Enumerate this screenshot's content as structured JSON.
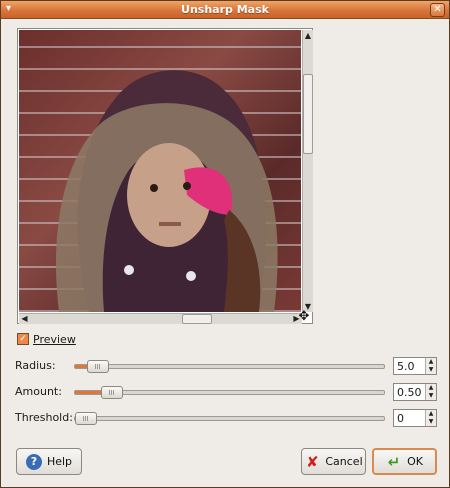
{
  "window": {
    "title": "Unsharp Mask",
    "close_symbol": "✕",
    "menu_symbol": "▾"
  },
  "preview": {
    "label": "Preview",
    "checked": true
  },
  "params": [
    {
      "label": "Radius",
      "value": "5.0",
      "fill": 0.06
    },
    {
      "label": "Amount",
      "value": "0.50",
      "fill": 0.1
    },
    {
      "label": "Threshold",
      "value": "0",
      "fill": 0.0
    }
  ],
  "buttons": {
    "help": "Help",
    "cancel": "Cancel",
    "ok": "OK"
  },
  "icons": {
    "help": "help-icon",
    "cancel": "cancel-icon",
    "ok": "ok-arrow-icon",
    "navigate": "navigate-icon"
  },
  "colors": {
    "title_bar": "#d8743b",
    "accent": "#e0773a",
    "background": "#efebe7"
  }
}
